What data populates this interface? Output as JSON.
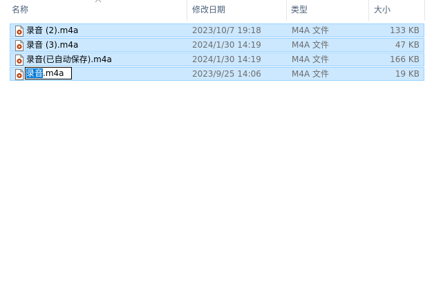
{
  "columns": {
    "name": "名称",
    "modified": "修改日期",
    "type": "类型",
    "size": "大小"
  },
  "files": [
    {
      "name": "录音 (2).m4a",
      "modified": "2023/10/7 19:18",
      "type": "M4A 文件",
      "size": "133 KB"
    },
    {
      "name": "录音 (3).m4a",
      "modified": "2024/1/30 14:19",
      "type": "M4A 文件",
      "size": "47 KB"
    },
    {
      "name": "录音(已自动保存).m4a",
      "modified": "2024/1/30 14:19",
      "type": "M4A 文件",
      "size": "166 KB"
    },
    {
      "name": "录音.m4a",
      "modified": "2023/9/25 14:06",
      "type": "M4A 文件",
      "size": "19 KB"
    }
  ],
  "rename": {
    "selected_text": "录音",
    "rest_text": ".m4a"
  },
  "colors": {
    "selection_bg": "#cce8ff",
    "selection_border": "#99d1ff",
    "text_highlight": "#0078d7",
    "header_text": "#4c607a"
  },
  "icons": {
    "file": "audio-file-icon",
    "sort": "sort-chevron-up-icon"
  }
}
